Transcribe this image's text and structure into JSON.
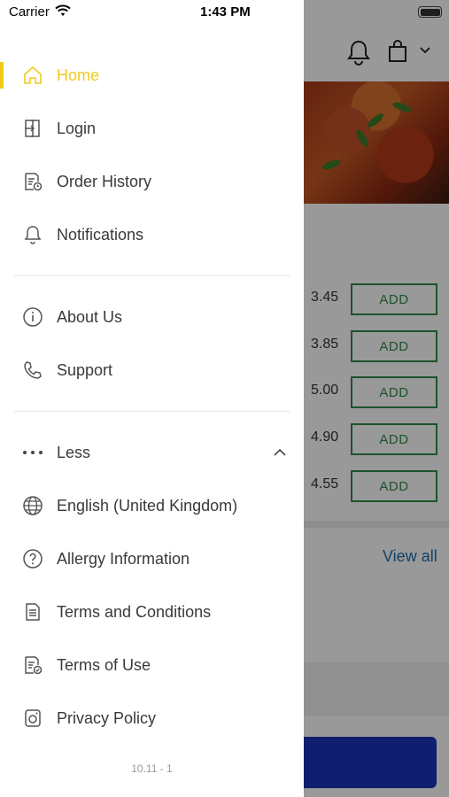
{
  "status_bar": {
    "carrier": "Carrier",
    "time": "1:43 PM"
  },
  "menu": {
    "home": "Home",
    "login": "Login",
    "order_history": "Order History",
    "notifications": "Notifications",
    "about_us": "About Us",
    "support": "Support",
    "less": "Less",
    "language": "English (United Kingdom)",
    "allergy": "Allergy Information",
    "terms_conditions": "Terms and Conditions",
    "terms_use": "Terms of Use",
    "privacy": "Privacy Policy"
  },
  "version": "10.11 - 1",
  "background": {
    "prices": [
      "3.45",
      "3.85",
      "5.00",
      "4.90",
      "4.55"
    ],
    "add_label": "ADD",
    "view_all": "View all"
  },
  "colors": {
    "accent": "#f2c91c",
    "add_green": "#2f8a48",
    "cta_blue": "#1933b8"
  }
}
